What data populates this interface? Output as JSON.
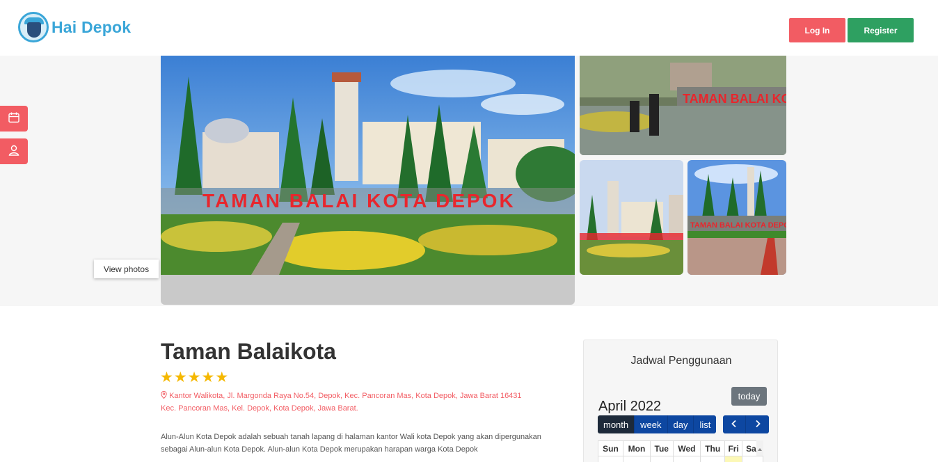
{
  "header": {
    "logo_text": "Hai Depok",
    "login_label": "Log In",
    "register_label": "Register"
  },
  "gallery": {
    "main_sign_text": "TAMAN BALAI KOTA DEPOK",
    "view_photos_label": "View photos"
  },
  "side_actions": [
    {
      "icon": "calendar-icon"
    },
    {
      "icon": "user-icon"
    }
  ],
  "place": {
    "title": "Taman Balaikota",
    "rating": 5,
    "address_line1": "Kantor Walikota, Jl. Margonda Raya No.54, Depok, Kec. Pancoran Mas, Kota Depok, Jawa Barat 16431",
    "address_line2": "Kec. Pancoran Mas, Kel. Depok, Kota Depok, Jawa Barat.",
    "description": "Alun-Alun Kota Depok adalah sebuah tanah lapang di halaman kantor Wali kota Depok yang akan dipergunakan sebagai Alun-alun Kota Depok. Alun-alun Kota Depok merupakan harapan warga Kota Depok"
  },
  "calendar": {
    "heading": "Jadwal Penggunaan",
    "today_label": "today",
    "month_label": "April 2022",
    "views": [
      "month",
      "week",
      "day",
      "list"
    ],
    "active_view": "month",
    "weekdays": [
      "Sun",
      "Mon",
      "Tue",
      "Wed",
      "Thu",
      "Fri",
      "Sat"
    ]
  },
  "colors": {
    "primary_red": "#f25c63",
    "register_green": "#2ea061",
    "logo_blue": "#3aa6d8",
    "star_gold": "#f5b800",
    "calendar_blue": "#0d47a1"
  }
}
